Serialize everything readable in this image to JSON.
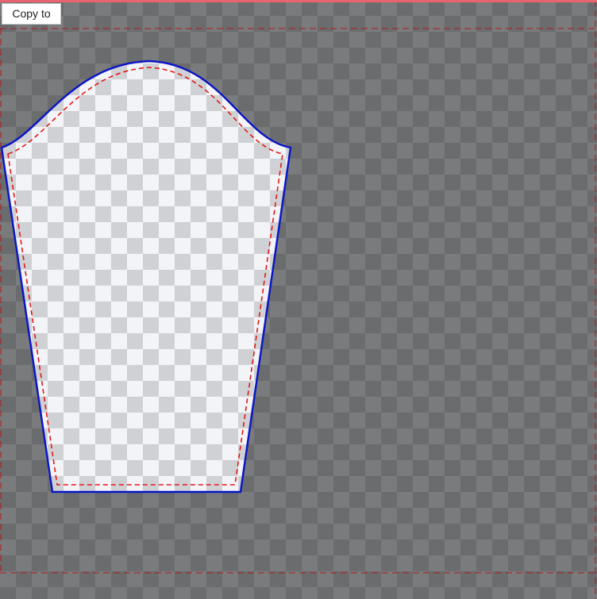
{
  "toolbar": {
    "copy_to_label": "Copy to"
  },
  "colors": {
    "background_dark": "#6b6c6e",
    "background_light": "#7a7b7d",
    "piece_light": "#f3f4f7",
    "piece_dark": "#d0d1d4",
    "cut_line": "#0b16c4",
    "seam_line": "#e11919",
    "top_strip": "#e8646e"
  },
  "piece": {
    "name": "sleeve-pattern-piece",
    "outline_style": "solid",
    "seam_allowance_style": "dashed"
  }
}
